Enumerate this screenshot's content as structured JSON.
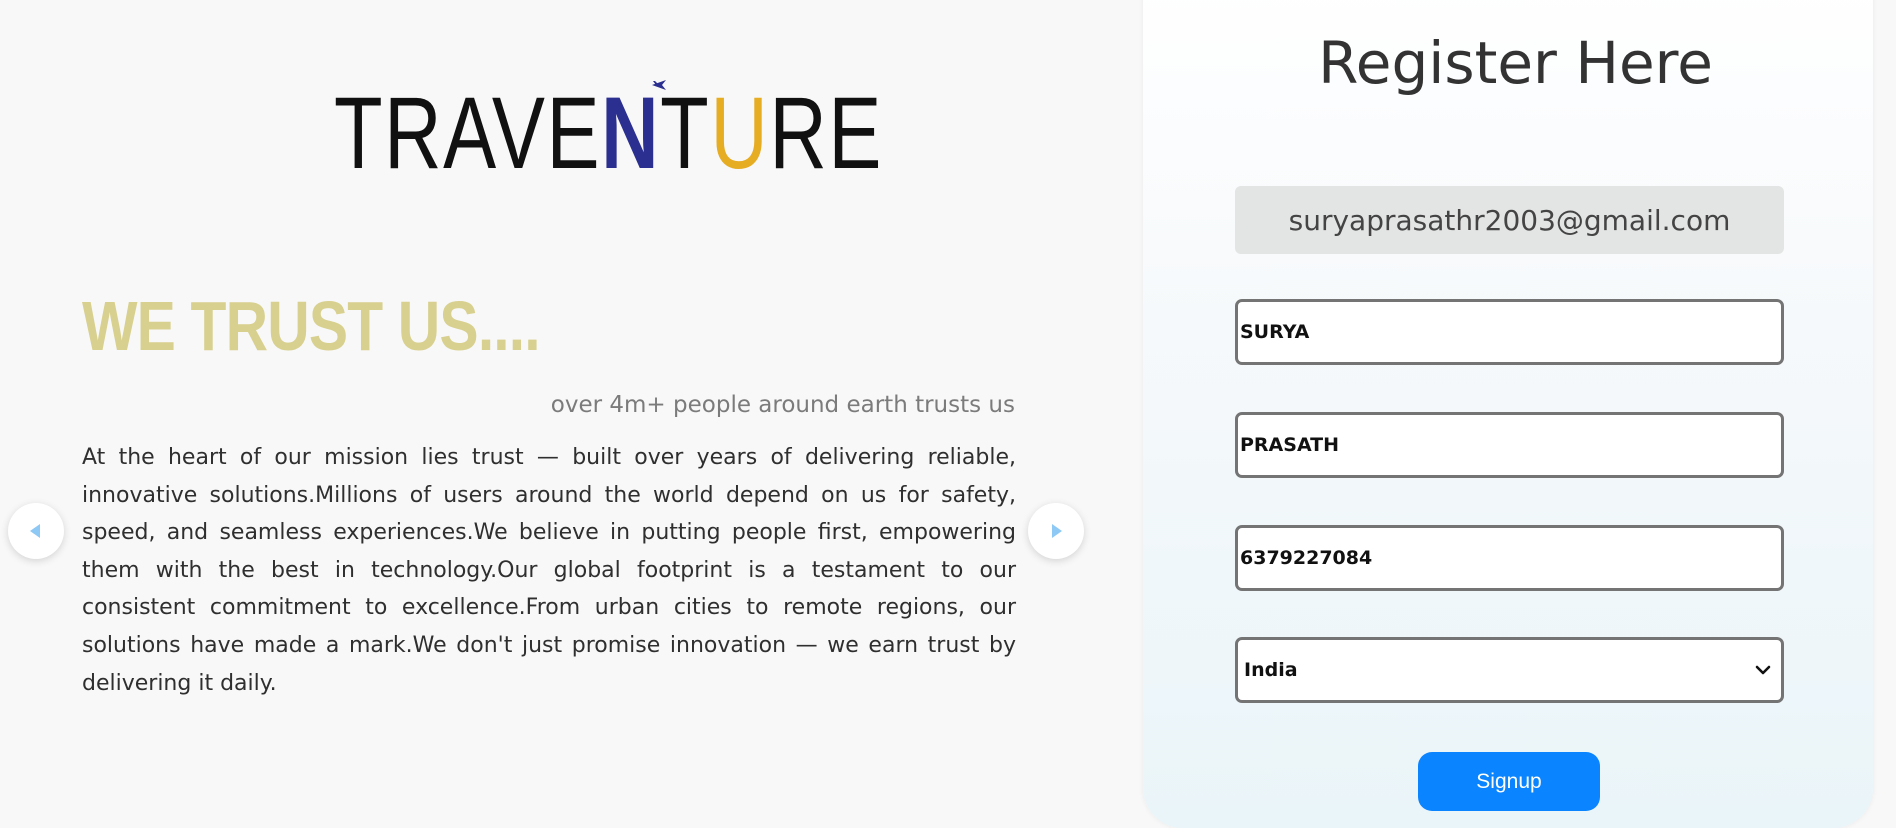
{
  "brand": {
    "logo_text": "TRAVENTURE",
    "logo_color_main": "#111111",
    "logo_color_n": "#2b2f8f",
    "logo_color_u": "#e6ac22"
  },
  "hero": {
    "headline": "WE TRUST US....",
    "subline": "over 4m+ people around earth trusts us",
    "paragraph": "At the heart of our mission lies trust — built over years of delivering reliable, innovative solutions.Millions of users around the world depend on us for safety, speed, and seamless experiences.We believe in putting people first, empowering them with the best in technology.Our global footprint is a testament to our consistent commitment to excellence.From urban cities to remote regions, our solutions have made a mark.We don't just promise innovation — we earn trust by delivering it daily.",
    "headline_color": "#d8d08f"
  },
  "carousel": {
    "prev_icon": "arrow-left-icon",
    "next_icon": "arrow-right-icon",
    "arrow_color": "#8ec8f5"
  },
  "register": {
    "title": "Register Here",
    "email": "suryaprasathr2003@gmail.com",
    "first_name": "SURYA",
    "last_name": "PRASATH",
    "phone": "6379227084",
    "country": "India",
    "signup_label": "Signup",
    "button_color": "#0b84ff"
  }
}
